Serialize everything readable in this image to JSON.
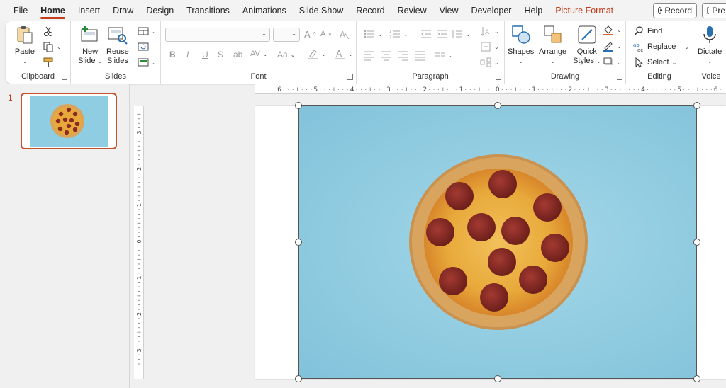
{
  "menu": {
    "tabs": [
      "File",
      "Home",
      "Insert",
      "Draw",
      "Design",
      "Transitions",
      "Animations",
      "Slide Show",
      "Record",
      "Review",
      "View",
      "Developer",
      "Help",
      "Picture Format"
    ],
    "active": "Home",
    "record_button": "Record",
    "present_button": "Pre"
  },
  "ribbon": {
    "clipboard": {
      "label": "Clipboard",
      "paste": "Paste"
    },
    "slides": {
      "label": "Slides",
      "new_slide_1": "New",
      "new_slide_2": "Slide",
      "reuse_1": "Reuse",
      "reuse_2": "Slides"
    },
    "font": {
      "label": "Font",
      "bold": "B",
      "italic": "I",
      "underline": "U",
      "shadow": "S",
      "strike": "ab",
      "spacing": "AV",
      "case": "Aa",
      "grow": "A",
      "shrink": "A"
    },
    "paragraph": {
      "label": "Paragraph"
    },
    "drawing": {
      "label": "Drawing",
      "shapes": "Shapes",
      "arrange": "Arrange",
      "quick_styles_1": "Quick",
      "quick_styles_2": "Styles"
    },
    "editing": {
      "label": "Editing",
      "find": "Find",
      "replace": "Replace",
      "select": "Select"
    },
    "voice": {
      "label": "Voice",
      "dictate": "Dictate"
    }
  },
  "thumbnails": [
    {
      "number": "1"
    }
  ],
  "hruler_labels": [
    "6",
    "5",
    "4",
    "3",
    "2",
    "1",
    "0",
    "1",
    "2",
    "3",
    "4",
    "5",
    "6"
  ],
  "vruler_labels": [
    "3",
    "2",
    "1",
    "0",
    "1",
    "2",
    "3"
  ],
  "colors": {
    "accent": "#c43e1c",
    "picture_bg": "#8fcbe0",
    "crust": "#d9a55e",
    "cheese": "#e8a93a",
    "pepperoni": "#8a2a25"
  }
}
